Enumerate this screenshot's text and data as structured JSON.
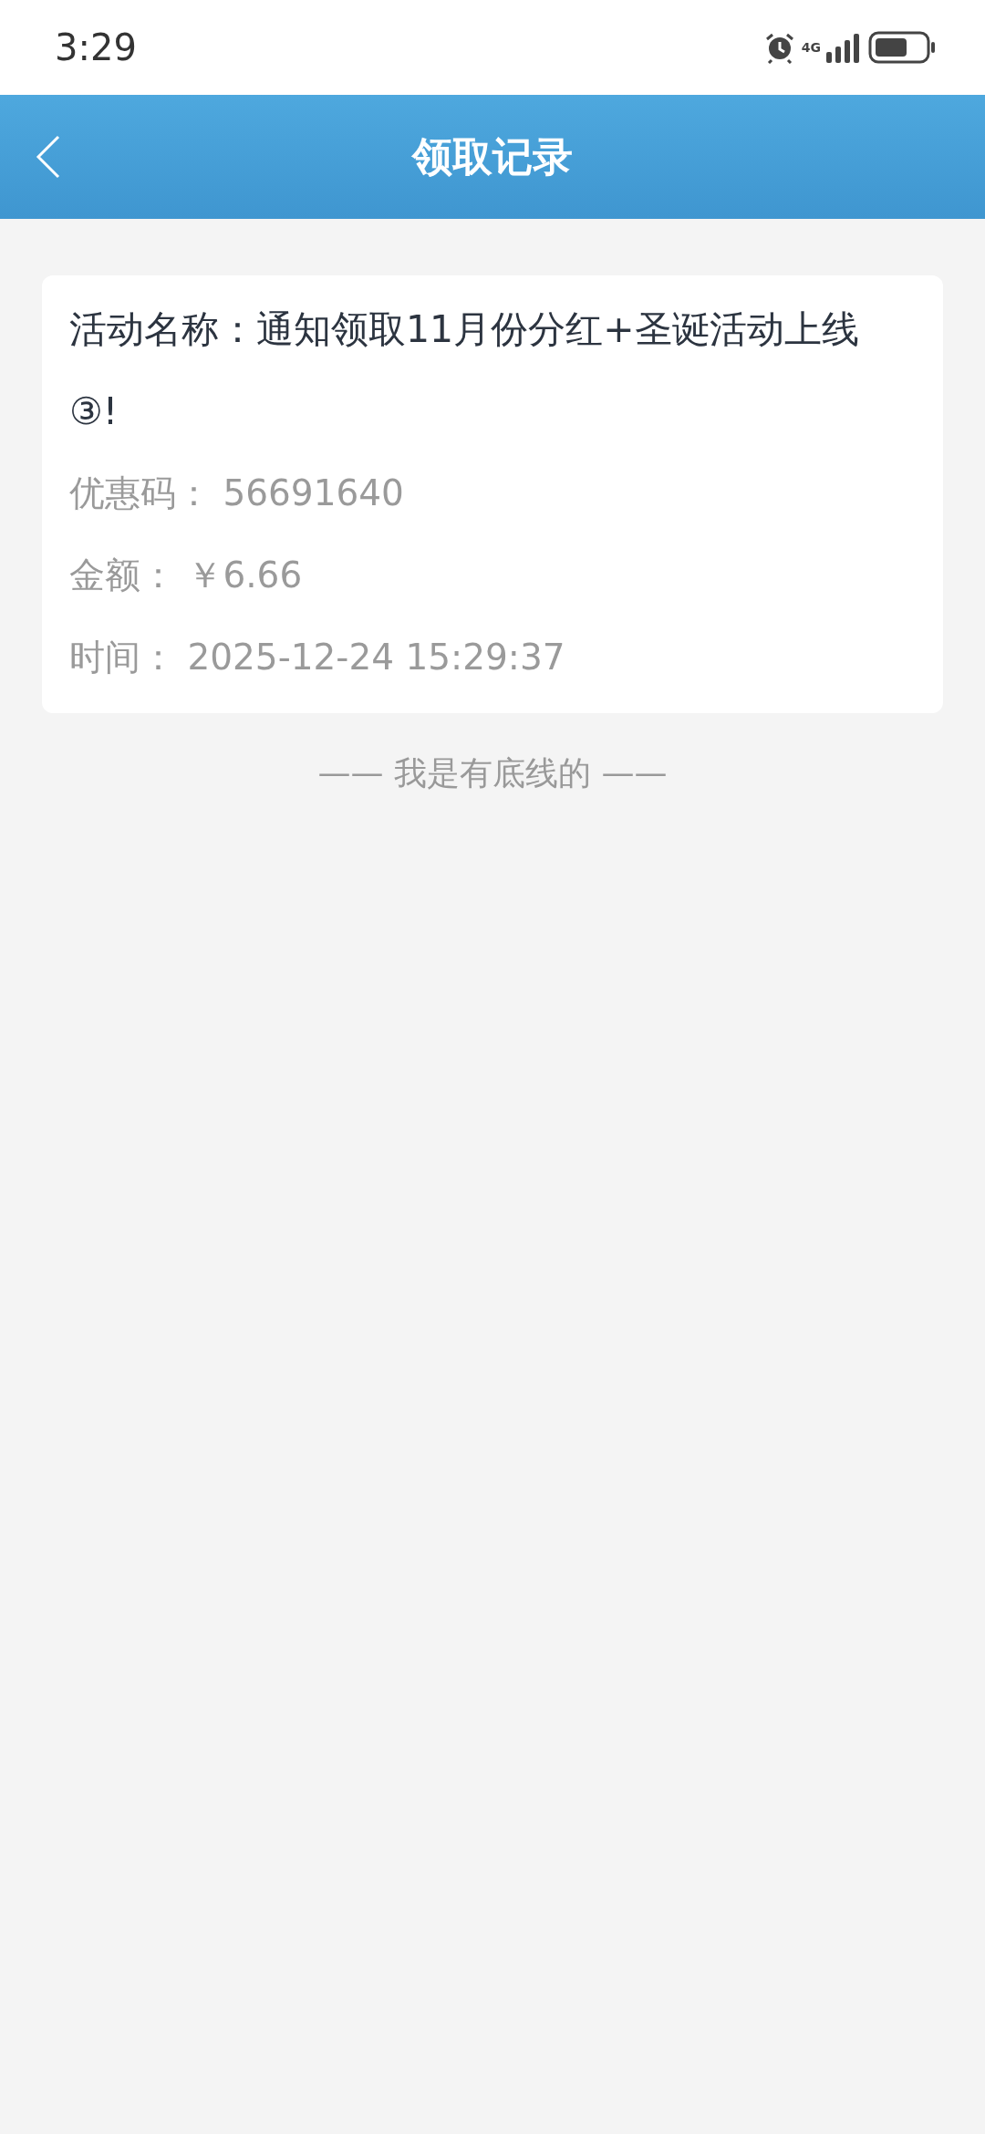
{
  "status_bar": {
    "time": "3:29",
    "network": "4G"
  },
  "header": {
    "title": "领取记录"
  },
  "records": [
    {
      "title_label": "活动名称：",
      "title": "通知领取11月份分红+圣诞活动上线③!",
      "fields": [
        {
          "label": "优惠码：",
          "value": "56691640"
        },
        {
          "label": "金额：",
          "value": "￥6.66"
        },
        {
          "label": "时间：",
          "value": "2025-12-24 15:29:37"
        }
      ]
    }
  ],
  "footer": "—— 我是有底线的 ——"
}
